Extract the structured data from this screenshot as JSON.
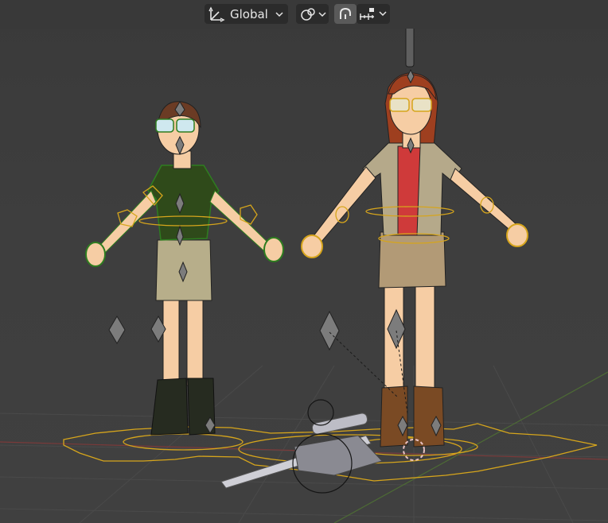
{
  "header": {
    "transform_orientation": {
      "label": "Global",
      "icon": "transform-orientation-icon"
    },
    "pivot_point": {
      "icon": "pivot-point-icon"
    },
    "snap": {
      "toggle_icon": "magnet-snap-icon",
      "menu_icon": "snap-increment-icon",
      "enabled": true
    }
  },
  "viewport": {
    "objects": [
      "character-boy",
      "character-girl",
      "rifle-prop"
    ],
    "colors": {
      "background": "#3d3d3d",
      "rig_outline": "#d6a51c",
      "selected_green": "#2e7d20",
      "header": "#393939"
    }
  }
}
